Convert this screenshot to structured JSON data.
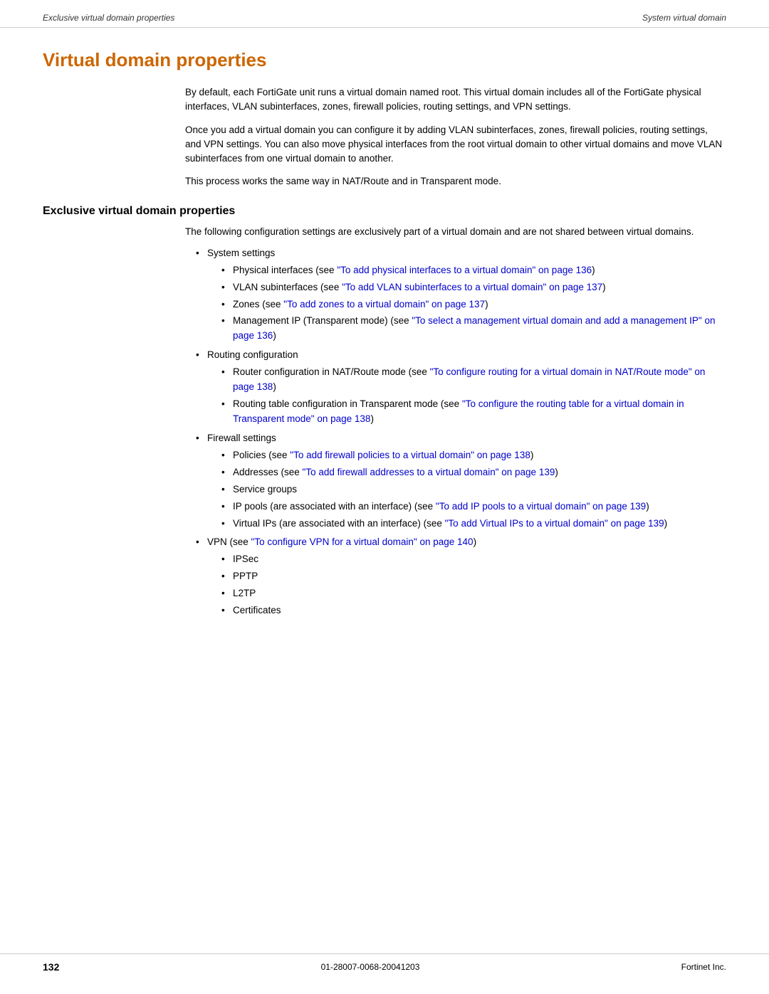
{
  "header": {
    "left": "Exclusive virtual domain properties",
    "right": "System virtual domain"
  },
  "footer": {
    "page_number": "132",
    "doc_id": "01-28007-0068-20041203",
    "company": "Fortinet Inc."
  },
  "page_title": "Virtual domain properties",
  "paragraphs": [
    "By default, each FortiGate unit runs a virtual domain named root. This virtual domain includes all of the FortiGate physical interfaces, VLAN subinterfaces, zones, firewall policies, routing settings, and VPN settings.",
    "Once you add a virtual domain you can configure it by adding VLAN subinterfaces, zones, firewall policies, routing settings, and VPN settings. You can also move physical interfaces from the root virtual domain to other virtual domains and move VLAN subinterfaces from one virtual domain to another.",
    "This process works the same way in NAT/Route and in Transparent mode."
  ],
  "section": {
    "heading": "Exclusive virtual domain properties",
    "intro": "The following configuration settings are exclusively part of a virtual domain and are not shared between virtual domains.",
    "list": [
      {
        "label": "System settings",
        "children": [
          {
            "label": "Physical interfaces (see ",
            "link_text": "\"To add physical interfaces to a virtual domain\" on page 136",
            "link_href": "#",
            "suffix": ")"
          },
          {
            "label": "VLAN subinterfaces (see ",
            "link_text": "\"To add VLAN subinterfaces to a virtual domain\" on page 137",
            "link_href": "#",
            "suffix": ")"
          },
          {
            "label": "Zones (see ",
            "link_text": "\"To add zones to a virtual domain\" on page 137",
            "link_href": "#",
            "suffix": ")"
          },
          {
            "label": "Management IP (Transparent mode) (see ",
            "link_text": "\"To select a management virtual domain and add a management IP\" on page 136",
            "link_href": "#",
            "suffix": ")"
          }
        ]
      },
      {
        "label": "Routing configuration",
        "children": [
          {
            "label": "Router configuration in NAT/Route mode (see ",
            "link_text": "\"To configure routing for a virtual domain in NAT/Route mode\" on page 138",
            "link_href": "#",
            "suffix": ")"
          },
          {
            "label": "Routing table configuration in Transparent mode (see ",
            "link_text": "\"To configure the routing table for a virtual domain in Transparent mode\" on page 138",
            "link_href": "#",
            "suffix": ")"
          }
        ]
      },
      {
        "label": "Firewall settings",
        "children": [
          {
            "label": "Policies (see ",
            "link_text": "\"To add firewall policies to a virtual domain\" on page 138",
            "link_href": "#",
            "suffix": ")"
          },
          {
            "label": "Addresses (see ",
            "link_text": "\"To add firewall addresses to a virtual domain\" on page 139",
            "link_href": "#",
            "suffix": ")"
          },
          {
            "label": "Service groups",
            "link_text": null,
            "suffix": ""
          },
          {
            "label": "IP pools (are associated with an interface) (see ",
            "link_text": "\"To add IP pools to a virtual domain\" on page 139",
            "link_href": "#",
            "suffix": ")"
          },
          {
            "label": "Virtual IPs (are associated with an interface) (see ",
            "link_text": "\"To add Virtual IPs to a virtual domain\" on page 139",
            "link_href": "#",
            "suffix": ")"
          }
        ]
      },
      {
        "label": "VPN (see ",
        "link_text": "\"To configure VPN for a virtual domain\" on page 140",
        "link_href": "#",
        "suffix": ")",
        "children": [
          {
            "label": "IPSec"
          },
          {
            "label": "PPTP"
          },
          {
            "label": "L2TP"
          },
          {
            "label": "Certificates"
          }
        ]
      }
    ]
  }
}
